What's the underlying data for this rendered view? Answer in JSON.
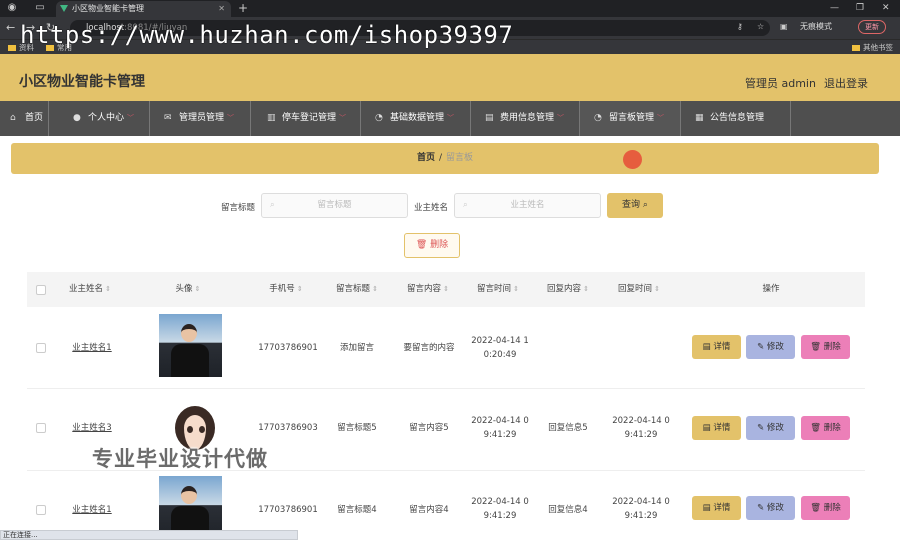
{
  "browser": {
    "tab_title": "小区物业智能卡管理",
    "url_host": "localhost",
    "url_path": ":8081/#/liuyan",
    "incognito_label": "无痕模式",
    "update_label": "更新",
    "bookmarks": [
      "资料",
      "常用"
    ],
    "other_bookmarks": "其他书签",
    "status_text": "正在连接..."
  },
  "watermark": {
    "url_text": "https://www.huzhan.com/ishop39397",
    "cn_text": "专业毕业设计代做"
  },
  "header": {
    "title": "小区物业智能卡管理",
    "admin_label": "管理员 admin",
    "logout_label": "退出登录"
  },
  "menu": [
    {
      "icon": "home-icon",
      "label": "首页"
    },
    {
      "icon": "user-icon",
      "label": "个人中心"
    },
    {
      "icon": "mail-icon",
      "label": "管理员管理"
    },
    {
      "icon": "car-icon",
      "label": "停车登记管理"
    },
    {
      "icon": "data-icon",
      "label": "基础数据管理"
    },
    {
      "icon": "fee-icon",
      "label": "费用信息管理"
    },
    {
      "icon": "message-icon",
      "label": "留言板管理"
    },
    {
      "icon": "notice-icon",
      "label": "公告信息管理"
    }
  ],
  "breadcrumb": {
    "home": "首页",
    "sep": "/",
    "current": "留言板"
  },
  "search": {
    "title_label": "留言标题",
    "title_placeholder": "留言标题",
    "owner_label": "业主姓名",
    "owner_placeholder": "业主姓名",
    "query_button": "查询",
    "delete_button": "删除"
  },
  "table": {
    "columns": [
      "业主姓名",
      "头像",
      "手机号",
      "留言标题",
      "留言内容",
      "留言时间",
      "回复内容",
      "回复时间",
      "操作"
    ],
    "rows": [
      {
        "name": "业主姓名1",
        "phone": "17703786901",
        "title": "添加留言",
        "content": "要留言的内容",
        "time_a": "2022-04-14 1",
        "time_b": "0:20:49",
        "reply": "",
        "reply_time_a": "",
        "reply_time_b": ""
      },
      {
        "name": "业主姓名3",
        "phone": "17703786903",
        "title": "留言标题5",
        "content": "留言内容5",
        "time_a": "2022-04-14 0",
        "time_b": "9:41:29",
        "reply": "回复信息5",
        "reply_time_a": "2022-04-14 0",
        "reply_time_b": "9:41:29"
      },
      {
        "name": "业主姓名1",
        "phone": "17703786901",
        "title": "留言标题4",
        "content": "留言内容4",
        "time_a": "2022-04-14 0",
        "time_b": "9:41:29",
        "reply": "回复信息4",
        "reply_time_a": "2022-04-14 0",
        "reply_time_b": "9:41:29"
      }
    ],
    "actions": {
      "detail": "详情",
      "edit": "修改",
      "delete": "删除"
    }
  },
  "colors": {
    "brand_gold": "#e3c26a",
    "menu_dark": "#4f4f4f",
    "edit_purple": "#a9b4e0",
    "delete_pink": "#ec7fb8"
  }
}
